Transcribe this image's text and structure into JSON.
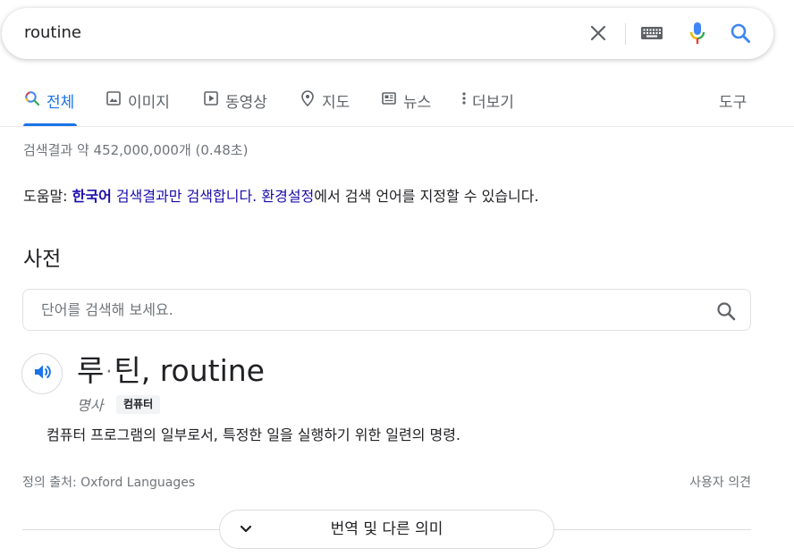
{
  "search": {
    "query": "routine",
    "icons": [
      "close-icon",
      "keyboard-icon",
      "mic-icon",
      "search-icon"
    ]
  },
  "tabs": [
    {
      "label": "전체",
      "icon": "search-icon",
      "active": true
    },
    {
      "label": "이미지",
      "icon": "image-icon"
    },
    {
      "label": "동영상",
      "icon": "video-icon"
    },
    {
      "label": "지도",
      "icon": "map-pin-icon"
    },
    {
      "label": "뉴스",
      "icon": "news-icon"
    },
    {
      "label": "더보기",
      "icon": "more-vert-icon"
    },
    {
      "label": "도구"
    }
  ],
  "result_stats": "검색결과 약 452,000,000개 (0.48초)",
  "spell_help": {
    "prefix": "도움말: ",
    "language_link": "한국어",
    "middle_link": " 검색결과만 검색합니다.",
    "space": " ",
    "settings_link": "환경설정",
    "suffix": "에서 검색 언어를 지정할 수 있습니다."
  },
  "dictionary": {
    "section_title": "사전",
    "search_placeholder": "단어를 검색해 보세요.",
    "headword_part1": "루",
    "headword_dot": "·",
    "headword_part2": "틴, routine",
    "part_of_speech": "명사",
    "domain_label": "컴퓨터",
    "definition": "컴퓨터 프로그램의 일부로서, 특정한 일을 실행하기 위한 일련의 명령.",
    "source": "정의 출처: Oxford Languages",
    "feedback": "사용자 의견",
    "more_button": "번역 및 다른 의미"
  },
  "colors": {
    "link": "#1a0dab",
    "accent": "#1a73e8",
    "secondary_text": "#70757a"
  }
}
